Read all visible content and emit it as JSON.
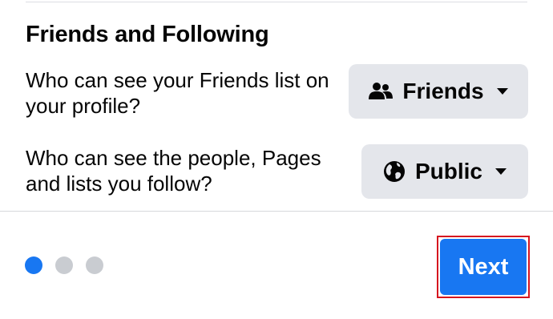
{
  "section": {
    "title": "Friends and Following"
  },
  "settings": [
    {
      "question": "Who can see your Friends list on your profile?",
      "audience": "Friends",
      "icon": "friends-icon"
    },
    {
      "question": "Who can see the people, Pages and lists you follow?",
      "audience": "Public",
      "icon": "globe-icon"
    }
  ],
  "pager": {
    "total_steps": 3,
    "current_step": 1
  },
  "footer": {
    "next_label": "Next"
  },
  "colors": {
    "accent": "#1877f2",
    "button_bg": "#e4e6eb",
    "inactive_dot": "#c9ccd1",
    "highlight_outline": "#d6161f"
  }
}
